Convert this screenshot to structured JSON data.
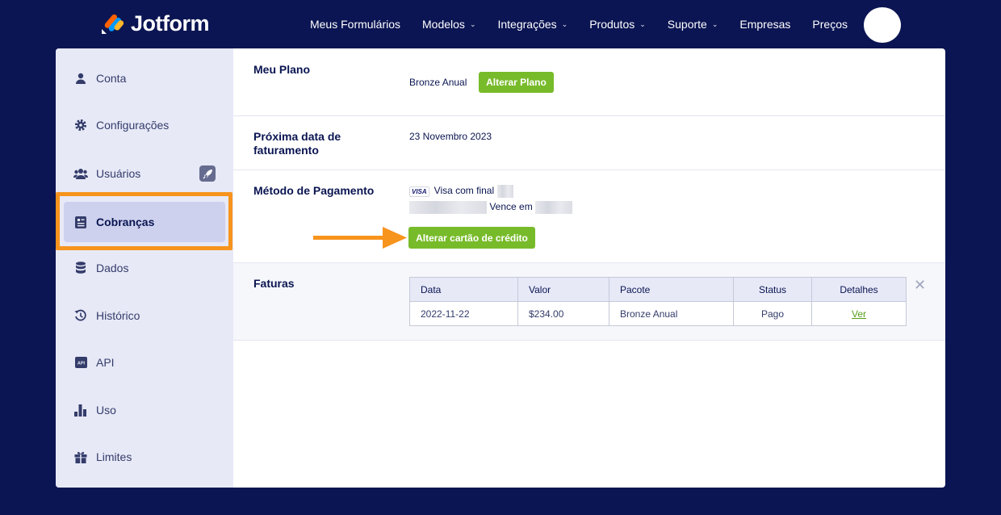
{
  "brand": {
    "name": "Jotform"
  },
  "nav": [
    {
      "label": "Meus Formulários",
      "dropdown": false
    },
    {
      "label": "Modelos",
      "dropdown": true
    },
    {
      "label": "Integrações",
      "dropdown": true
    },
    {
      "label": "Produtos",
      "dropdown": true
    },
    {
      "label": "Suporte",
      "dropdown": true
    },
    {
      "label": "Empresas",
      "dropdown": false
    },
    {
      "label": "Preços",
      "dropdown": false
    }
  ],
  "sidebar": {
    "items": [
      {
        "label": "Conta",
        "icon": "user-icon"
      },
      {
        "label": "Configurações",
        "icon": "gear-icon"
      },
      {
        "label": "Usuários",
        "icon": "users-icon"
      },
      {
        "label": "Cobranças",
        "icon": "billing-icon",
        "active": true
      },
      {
        "label": "Dados",
        "icon": "database-icon"
      },
      {
        "label": "Histórico",
        "icon": "history-icon"
      },
      {
        "label": "API",
        "icon": "api-icon"
      },
      {
        "label": "Uso",
        "icon": "bar-chart-icon"
      },
      {
        "label": "Limites",
        "icon": "gift-icon"
      }
    ]
  },
  "plan": {
    "title": "Meu Plano",
    "name": "Bronze Anual",
    "change_button": "Alterar Plano"
  },
  "billing_date": {
    "title": "Próxima data de faturamento",
    "value": "23 Novembro 2023"
  },
  "payment": {
    "title": "Método de Pagamento",
    "card_brand": "VISA",
    "card_text": "Visa com final",
    "expires_text": "Vence em",
    "change_button": "Alterar cartão de crédito"
  },
  "invoices": {
    "title": "Faturas",
    "columns": [
      "Data",
      "Valor",
      "Pacote",
      "Status",
      "Detalhes"
    ],
    "rows": [
      {
        "date": "2022-11-22",
        "amount": "$234.00",
        "package": "Bronze Anual",
        "status": "Pago",
        "details": "Ver"
      }
    ]
  },
  "colors": {
    "navy": "#0b1553",
    "green": "#78bb2a",
    "highlight": "#f7941d"
  }
}
